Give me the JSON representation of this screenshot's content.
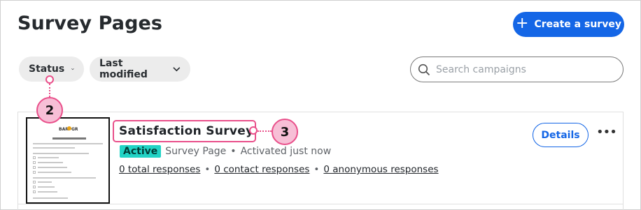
{
  "header": {
    "title": "Survey Pages",
    "create_button_label": "Create a survey",
    "create_button_icon": "plus-icon"
  },
  "filters": {
    "status_label": "Status",
    "last_modified_label": "Last modified"
  },
  "search": {
    "placeholder": "Search campaigns",
    "value": ""
  },
  "survey": {
    "title": "Satisfaction Survey",
    "status_badge": "Active",
    "type": "Survey Page",
    "separator": "•",
    "activated": "Activated just now",
    "links": {
      "total": "0 total responses",
      "contact": "0 contact responses",
      "anonymous": "0 anonymous responses"
    },
    "details_label": "Details",
    "more_label": "•••",
    "thumbnail": {
      "brand": "BAR GRILLE",
      "heading": "We need your input!"
    }
  },
  "callouts": {
    "marker_2": "2",
    "marker_3": "3"
  },
  "colors": {
    "primary": "#1466e6",
    "badge": "#22d3c5",
    "callout": "#e94f8a",
    "callout_fill": "#f7bfd6"
  }
}
